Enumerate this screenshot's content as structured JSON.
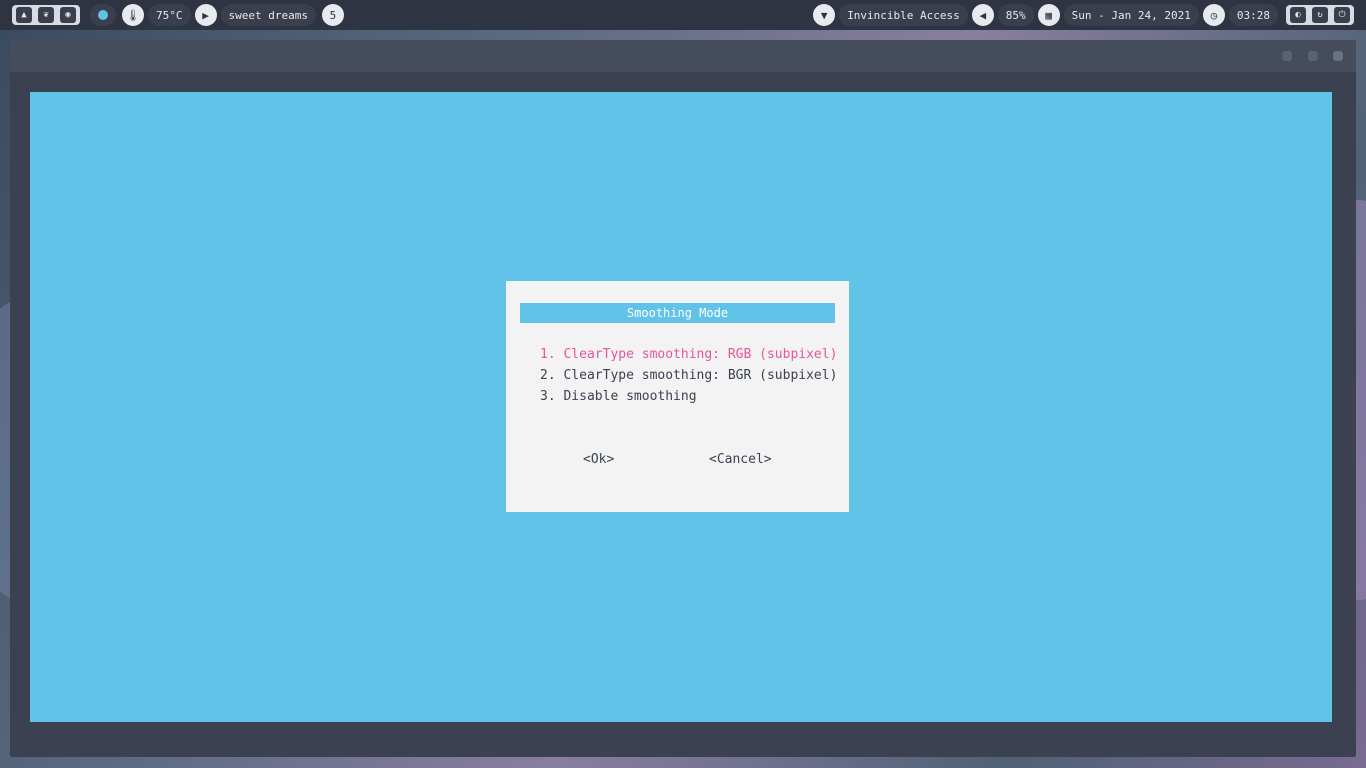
{
  "topbar": {
    "temperature": "75°C",
    "now_playing": "sweet dreams",
    "workspace_count": "5",
    "network_name": "Invincible Access",
    "volume": "85%",
    "date": "Sun - Jan 24, 2021",
    "time": "03:28",
    "icons": [
      "mountain-icon",
      "leaf-icon",
      "palette-icon",
      "thermometer-icon",
      "play-icon",
      "wifi-icon",
      "volume-icon",
      "calendar-icon",
      "clock-icon",
      "toggle-icon",
      "refresh-icon",
      "power-icon"
    ],
    "accent": "#61c2e8"
  },
  "window": {
    "background": "#3b4150",
    "canvas_color": "#62c3e9"
  },
  "dialog": {
    "title": "Smoothing Mode",
    "options": [
      "1. ClearType smoothing: RGB (subpixel)",
      "2. ClearType smoothing: BGR (subpixel)",
      "3. Disable smoothing"
    ],
    "selected_index": 0,
    "selected_color": "#e8559c",
    "ok_label": "<Ok>",
    "cancel_label": "<Cancel>"
  }
}
